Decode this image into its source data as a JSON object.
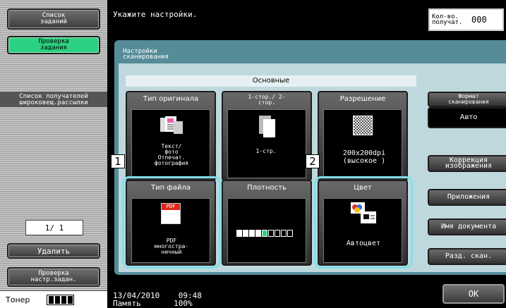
{
  "left_panel": {
    "job_list_label": "Список заданий",
    "job_check_label": "Проверка задания",
    "recipients_label": "Список получателей широковещ.рассылки",
    "page_indicator": "1/ 1",
    "delete_label": "Удалить",
    "check_settings_label": "Проверка настр.задан.",
    "toner_label": "Тонер"
  },
  "header": {
    "message": "Укажите настройки.",
    "count_label": "Кол-во. получат.",
    "count_value": "000"
  },
  "panel": {
    "title": "Настройки сканирования",
    "basic_label": "Основные",
    "cards": [
      {
        "title": "Тип оригинала",
        "value": "Текст/ фото Отпечат. фотография"
      },
      {
        "title": "1-стор./ 2-стор.",
        "value": "1-стр."
      },
      {
        "title": "Разрешение",
        "value": "200x200dpi (высокое )"
      },
      {
        "title": "Тип файла",
        "value": "PDF многостра- ничный",
        "icon_text": "PDF"
      },
      {
        "title": "Плотность",
        "value": ""
      },
      {
        "title": "Цвет",
        "value": "Автоцвет"
      }
    ],
    "scan_format": {
      "title": "Формат сканирования",
      "value": "Авто"
    },
    "side_buttons": [
      "Коррекция изображения",
      "Приложения",
      "Имя документа",
      "Разд. скан."
    ],
    "callouts": [
      "1",
      "2"
    ],
    "density_level": 5,
    "density_total": 9
  },
  "status": {
    "date": "13/04/2010",
    "time": "09:48",
    "memory_label": "Память",
    "memory_value": "100%"
  },
  "ok_label": "OK",
  "colors": {
    "accent_green": "#2bd182",
    "panel_teal": "#558c98",
    "selection": "#7fe0ea"
  }
}
